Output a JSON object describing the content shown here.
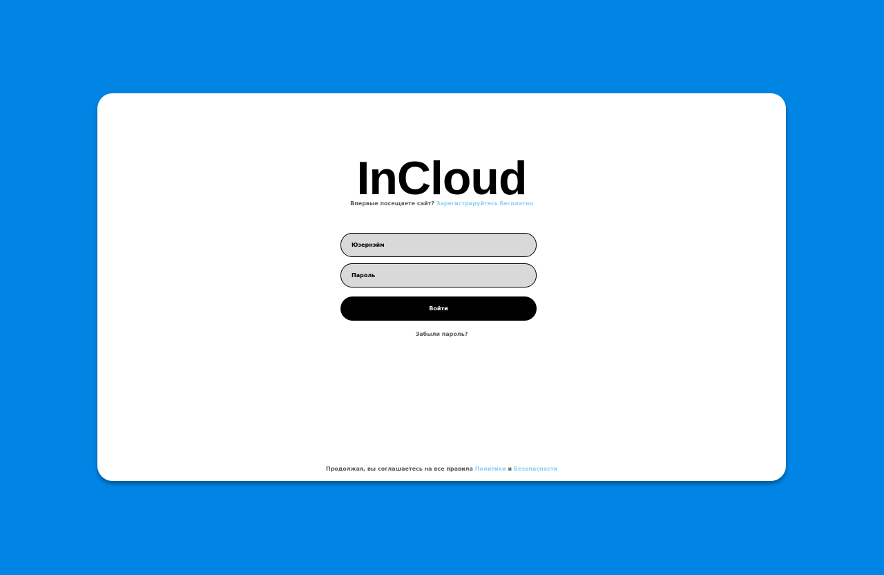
{
  "colors": {
    "background": "#0085e5",
    "card": "#ffffff",
    "link": "#8ed0f5",
    "muted_text": "#5e5a5a",
    "field_fill": "#d9d9d9",
    "button_fill": "#000000"
  },
  "brand": {
    "logo_text": "InCloud"
  },
  "signup": {
    "prompt": "Впервые посещяете сайт?",
    "link_label": "Зарегистрируйтесь бесплатно"
  },
  "form": {
    "username_placeholder": "Юзернэйм",
    "username_value": "",
    "password_placeholder": "Пароль",
    "password_value": "",
    "submit_label": "Войти",
    "forgot_label": "Забыли пароль?"
  },
  "footer": {
    "prefix": "Продолжая, вы соглашаетесь на все правила",
    "policy_link": "Политики",
    "conjunction": "и",
    "security_link": "Безопасности"
  }
}
